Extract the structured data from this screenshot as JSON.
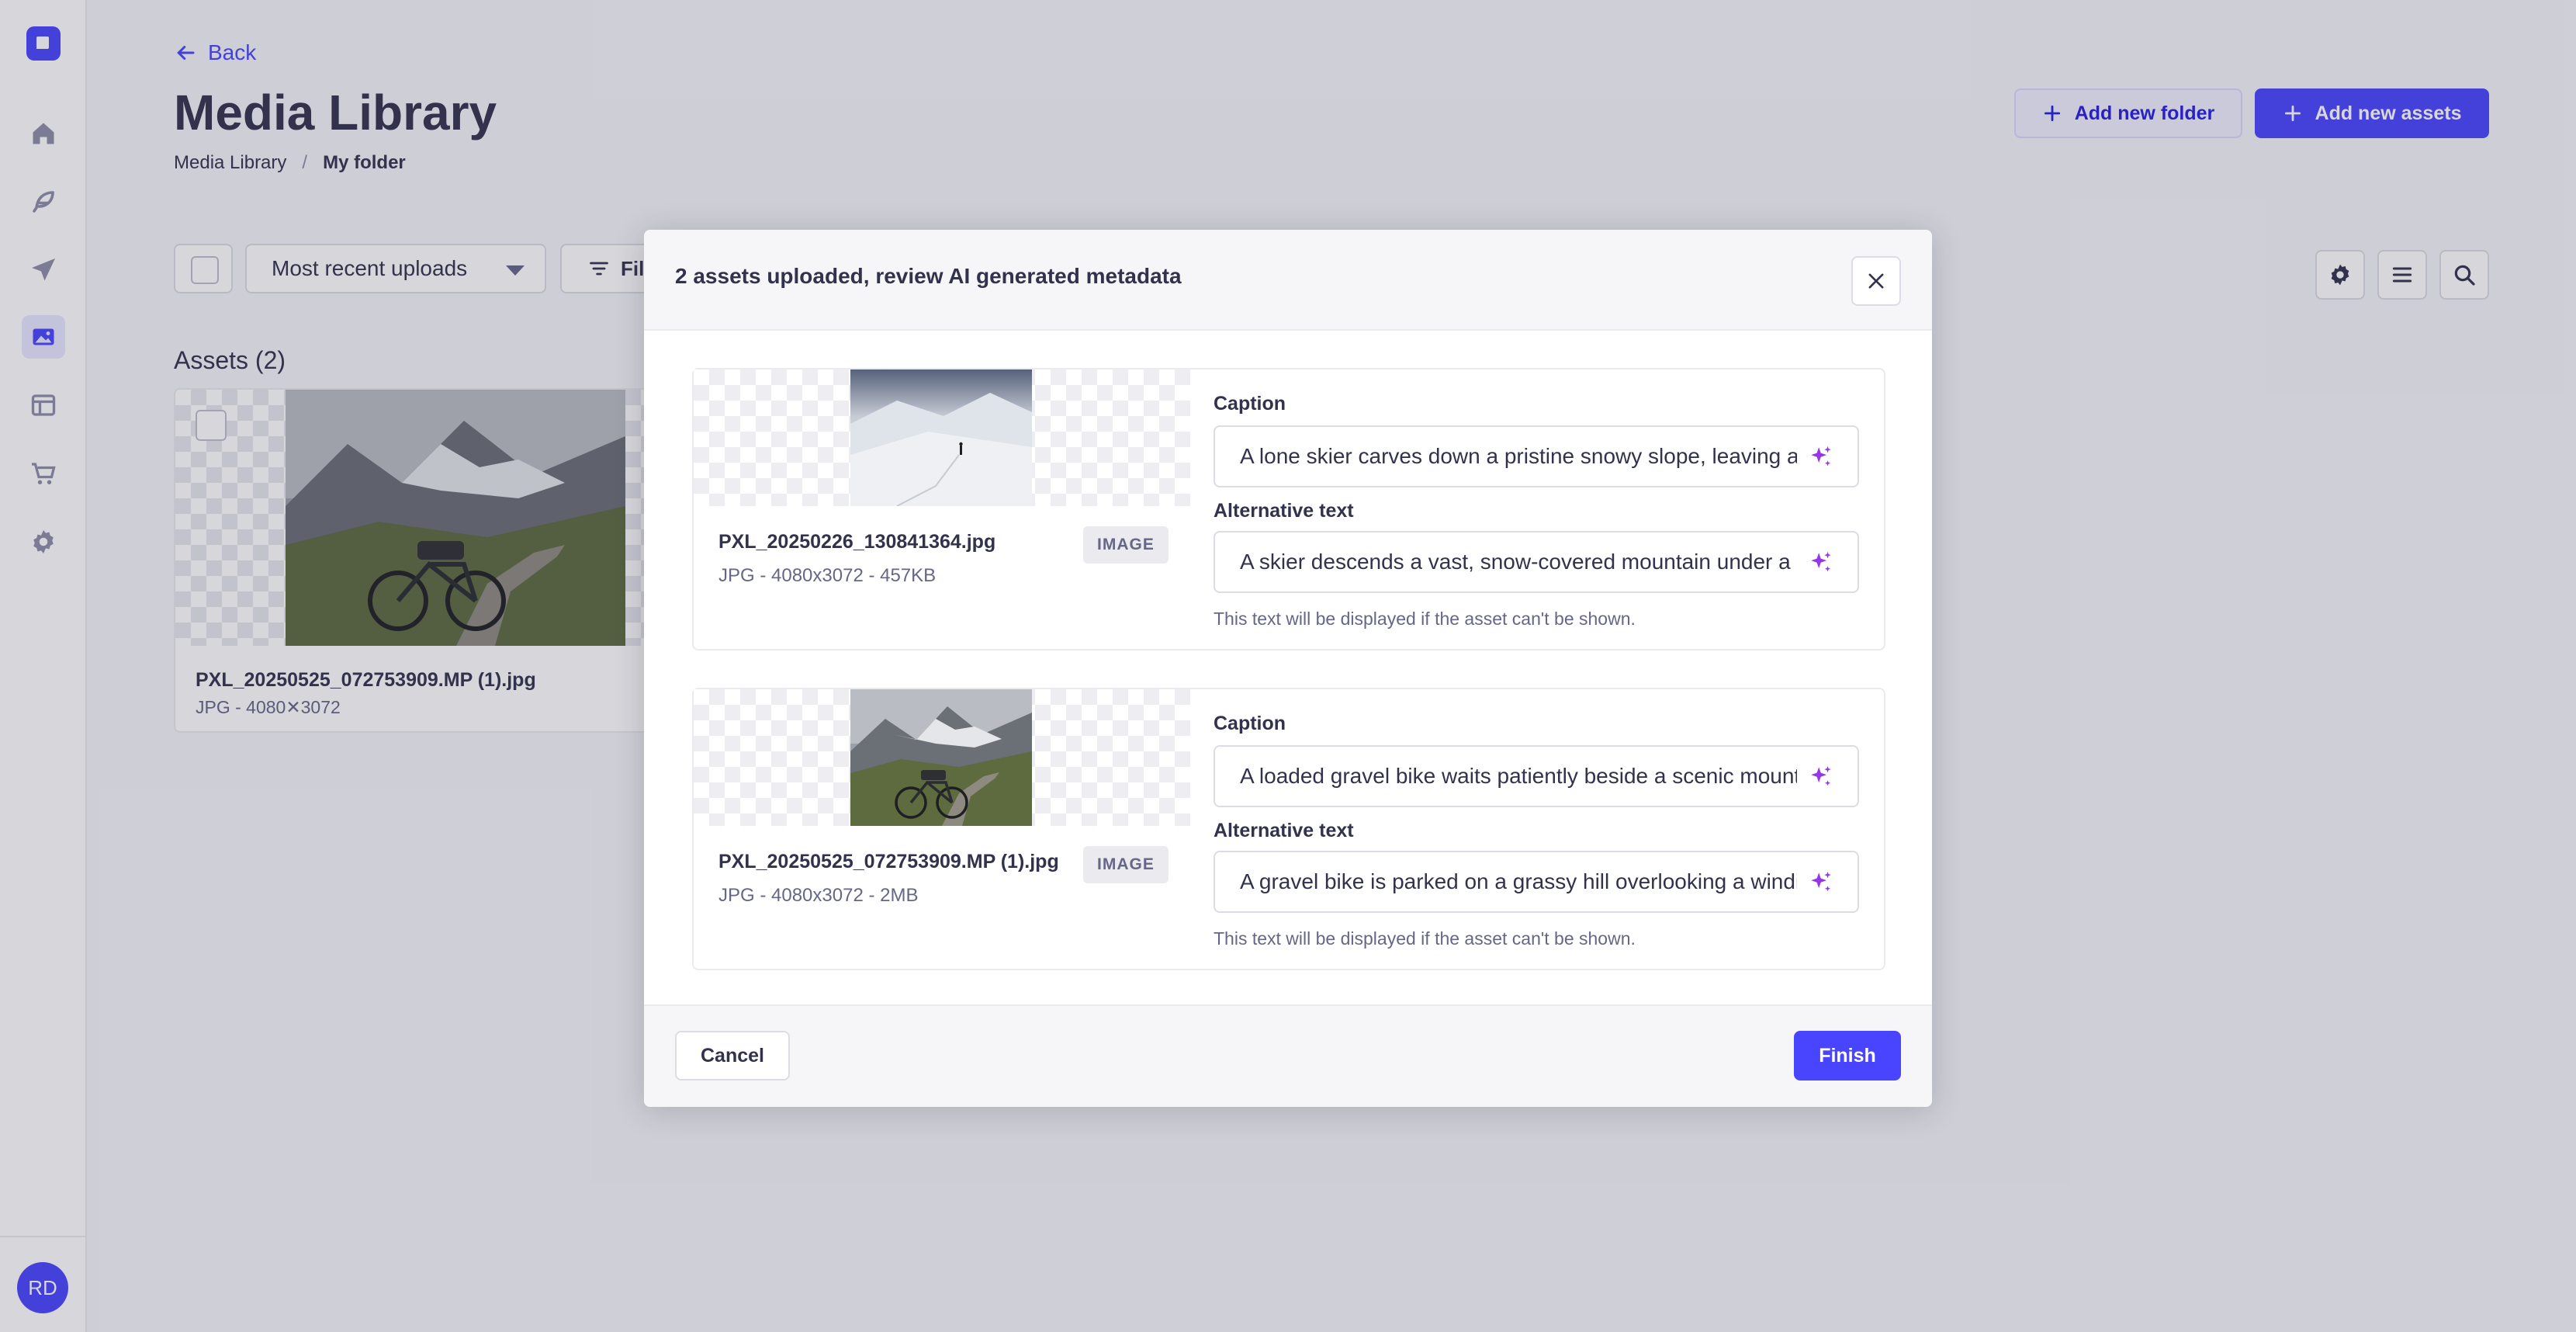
{
  "sidebar": {
    "items": [
      {
        "icon": "home-icon"
      },
      {
        "icon": "feather-icon"
      },
      {
        "icon": "paper-plane-icon"
      },
      {
        "icon": "images-icon"
      },
      {
        "icon": "layout-icon"
      },
      {
        "icon": "cart-icon"
      },
      {
        "icon": "gear-icon"
      }
    ],
    "avatar_initials": "RD"
  },
  "header": {
    "back_label": "Back",
    "title": "Media Library",
    "breadcrumb": [
      "Media Library",
      "My folder"
    ],
    "add_folder_label": "Add new folder",
    "add_assets_label": "Add new assets"
  },
  "toolbar": {
    "sort_value": "Most recent uploads",
    "filter_label": "Fil"
  },
  "assets": {
    "heading": "Assets (2)",
    "card": {
      "name": "PXL_20250525_072753909.MP (1).jpg",
      "meta": "JPG - 4080✕3072"
    }
  },
  "modal": {
    "title": "2 assets uploaded, review AI generated metadata",
    "caption_label": "Caption",
    "alt_label": "Alternative text",
    "alt_hint": "This text will be displayed if the asset can't be shown.",
    "items": [
      {
        "file_name": "PXL_20250226_130841364.jpg",
        "meta": "JPG - 4080x3072 - 457KB",
        "type": "IMAGE",
        "caption": "A lone skier carves down a pristine snowy slope, leaving a trail",
        "alt": "A skier descends a vast, snow-covered mountain under a cloudy sky"
      },
      {
        "file_name": "PXL_20250525_072753909.MP (1).jpg",
        "meta": "JPG - 4080x3072 - 2MB",
        "type": "IMAGE",
        "caption": "A loaded gravel bike waits patiently beside a scenic mountain road",
        "alt": "A gravel bike is parked on a grassy hill overlooking a winding road"
      }
    ],
    "cancel_label": "Cancel",
    "finish_label": "Finish"
  },
  "colors": {
    "primary": "#4945ff",
    "sparkle": "#9736e8"
  }
}
